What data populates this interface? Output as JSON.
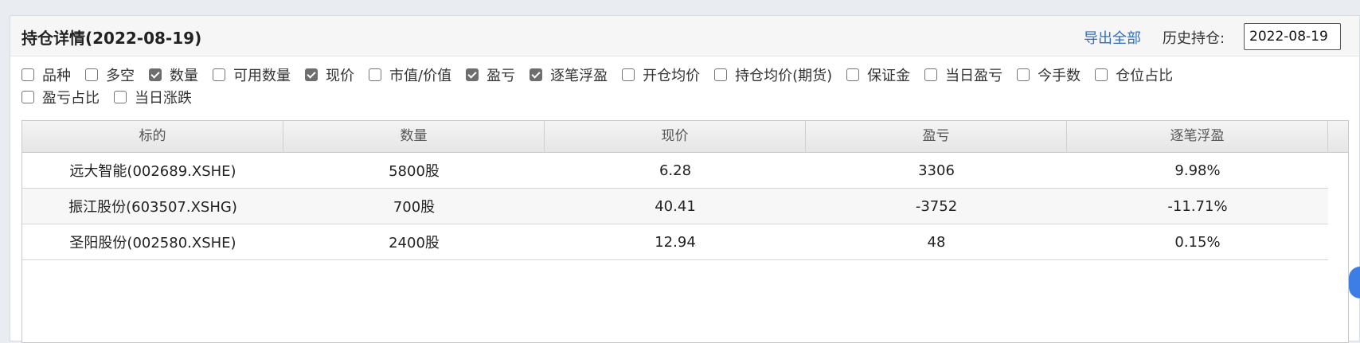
{
  "header": {
    "title": "持仓详情(2022-08-19)",
    "export_label": "导出全部",
    "history_label": "历史持仓:",
    "history_date": "2022-08-19"
  },
  "columns_options": [
    {
      "label": "品种",
      "checked": false
    },
    {
      "label": "多空",
      "checked": false
    },
    {
      "label": "数量",
      "checked": true
    },
    {
      "label": "可用数量",
      "checked": false
    },
    {
      "label": "现价",
      "checked": true
    },
    {
      "label": "市值/价值",
      "checked": false
    },
    {
      "label": "盈亏",
      "checked": true
    },
    {
      "label": "逐笔浮盈",
      "checked": true
    },
    {
      "label": "开仓均价",
      "checked": false
    },
    {
      "label": "持仓均价(期货)",
      "checked": false
    },
    {
      "label": "保证金",
      "checked": false
    },
    {
      "label": "当日盈亏",
      "checked": false
    },
    {
      "label": "今手数",
      "checked": false
    },
    {
      "label": "仓位占比",
      "checked": false
    },
    {
      "label": "盈亏占比",
      "checked": false
    },
    {
      "label": "当日涨跌",
      "checked": false
    }
  ],
  "table": {
    "headers": [
      "标的",
      "数量",
      "现价",
      "盈亏",
      "逐笔浮盈"
    ],
    "rows": [
      [
        "远大智能(002689.XSHE)",
        "5800股",
        "6.28",
        "3306",
        "9.98%"
      ],
      [
        "振江股份(603507.XSHG)",
        "700股",
        "40.41",
        "-3752",
        "-11.71%"
      ],
      [
        "圣阳股份(002580.XSHE)",
        "2400股",
        "12.94",
        "48",
        "0.15%"
      ]
    ]
  },
  "colors": {
    "link": "#2f6fc4",
    "accent_widget": "#3d7ee6"
  }
}
